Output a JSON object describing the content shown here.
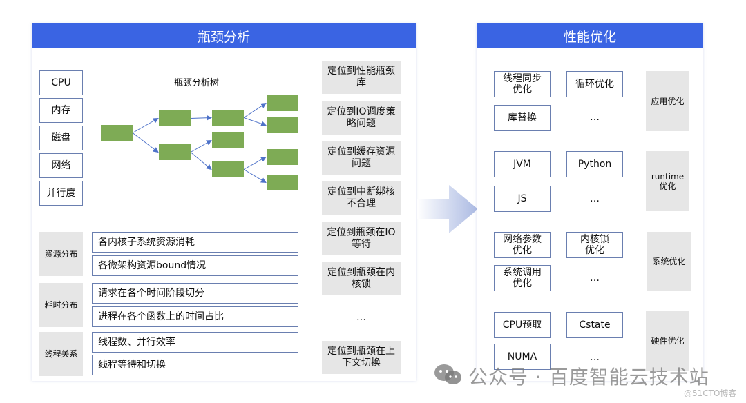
{
  "colors": {
    "header_blue": "#3a64e3",
    "node_green": "#7eab55",
    "arrow_blue": "#4e72c9",
    "gray_box": "#e6e6e6",
    "box_border": "#6a7fb0"
  },
  "left_panel": {
    "title": "瓶颈分析",
    "resources": [
      "CPU",
      "内存",
      "磁盘",
      "网络",
      "并行度"
    ],
    "tree_title": "瓶颈分析树",
    "tree": {
      "levels": 4,
      "nodes": [
        "root",
        "l1-top",
        "l1-bottom",
        "l2-a",
        "l2-b",
        "l2-c",
        "l3-a1",
        "l3-a2",
        "l3-c1",
        "l3-c2"
      ],
      "edges": [
        [
          "root",
          "l1-top"
        ],
        [
          "root",
          "l1-bottom"
        ],
        [
          "l1-top",
          "l2-a"
        ],
        [
          "l1-bottom",
          "l2-b"
        ],
        [
          "l1-bottom",
          "l2-c"
        ],
        [
          "l2-a",
          "l3-a1"
        ],
        [
          "l2-a",
          "l3-a2"
        ],
        [
          "l2-c",
          "l3-c1"
        ],
        [
          "l2-c",
          "l3-c2"
        ]
      ]
    },
    "groups": [
      {
        "label": "资源分布",
        "items": [
          "各内核子系统资源消耗",
          "各微架构资源bound情况"
        ]
      },
      {
        "label": "耗时分布",
        "items": [
          "请求在各个时间阶段切分",
          "进程在各个函数上的时间占比"
        ]
      },
      {
        "label": "线程关系",
        "items": [
          "线程数、并行效率",
          "线程等待和切换"
        ]
      }
    ],
    "locate_items": [
      "定位到性能瓶颈库",
      "定位到IO调度策略问题",
      "定位到缓存资源问题",
      "定位到中断绑核不合理",
      "定位到瓶颈在IO等待",
      "定位到瓶颈在内核锁",
      "…",
      "定位到瓶颈在上下文切换"
    ]
  },
  "arrow": {
    "icon": "right-arrow-icon"
  },
  "right_panel": {
    "title": "性能优化",
    "sections": [
      {
        "label": "应用优化",
        "col1": [
          "线程同步优化",
          "库替换"
        ],
        "col2": [
          "循环优化",
          "…"
        ]
      },
      {
        "label": "runtime优化",
        "col1": [
          "JVM",
          "JS"
        ],
        "col2": [
          "Python",
          "…"
        ]
      },
      {
        "label": "系统优化",
        "col1": [
          "网络参数优化",
          "系统调用优化"
        ],
        "col2": [
          "内核锁优化",
          "…"
        ]
      },
      {
        "label": "硬件优化",
        "col1": [
          "CPU预取",
          "NUMA"
        ],
        "col2": [
          "Cstate",
          "…"
        ]
      }
    ]
  },
  "watermark": {
    "text": "公众号 · 百度智能云技术站",
    "credit": "@51CTO博客"
  }
}
